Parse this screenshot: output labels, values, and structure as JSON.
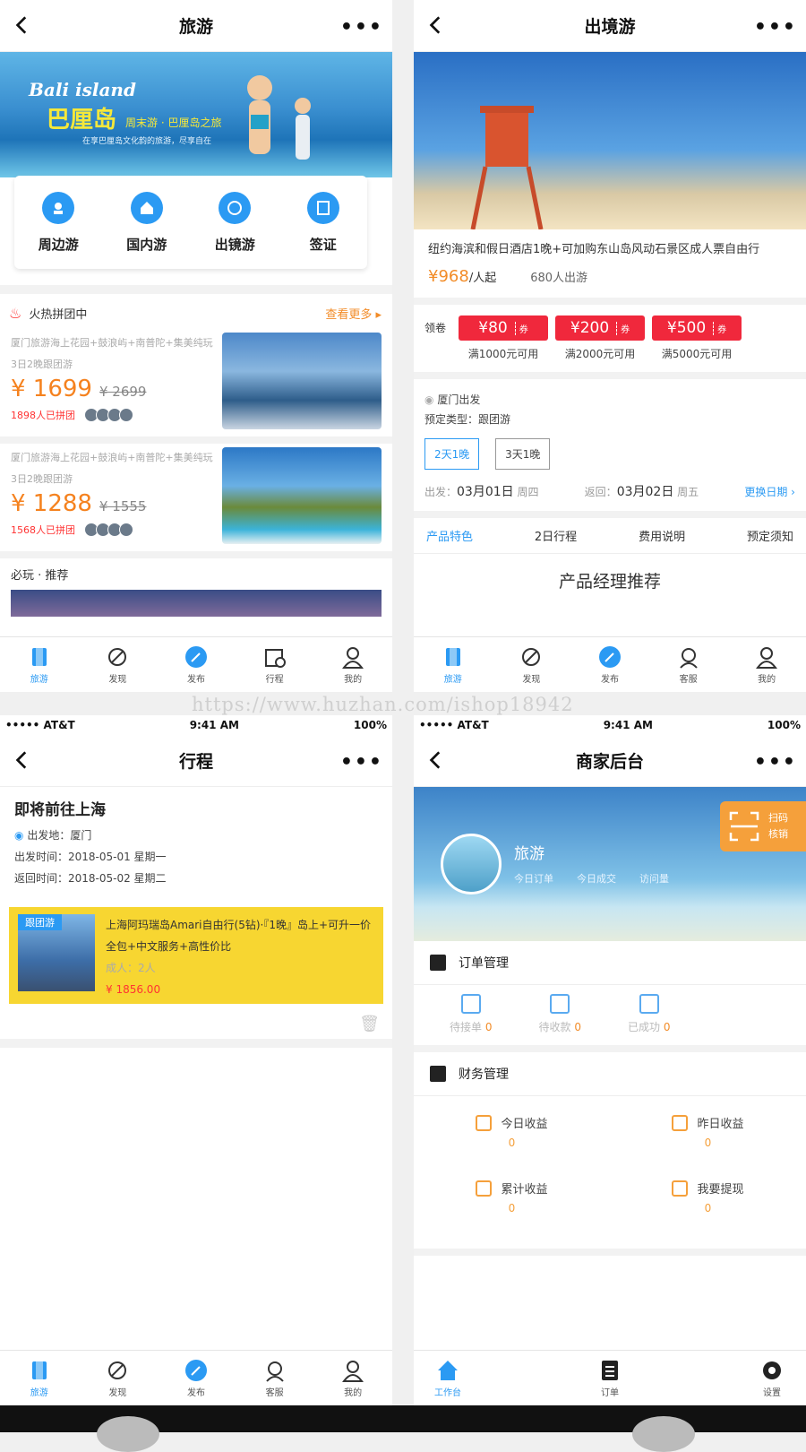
{
  "watermark": "https://www.huzhan.com/ishop18942",
  "tabbar_icons": [
    "tour-icon",
    "discover-icon",
    "publish-icon",
    "itinerary-icon",
    "service-icon",
    "profile-icon"
  ],
  "panel1": {
    "title": "旅游",
    "more": "•••",
    "banner": {
      "brand": "Bali island",
      "brand_cn": "巴厘岛",
      "sub": "周末游 · 巴厘岛之旅",
      "sub2": "在享巴厘岛文化韵的旅游，尽享自在"
    },
    "categories": [
      "周边游",
      "国内游",
      "出镜游",
      "签证"
    ],
    "hot_title": "火热拼团中",
    "see_more": "查看更多",
    "deals": [
      {
        "title": "厦门旅游海上花园+鼓浪屿+南普陀+集美纯玩3日2晚跟团游",
        "price": "¥ 1699",
        "old": "¥ 2699",
        "count": "1898人已拼团"
      },
      {
        "title": "厦门旅游海上花园+鼓浪屿+南普陀+集美纯玩3日2晚跟团游",
        "price": "¥ 1288",
        "old": "¥ 1555",
        "count": "1568人已拼团"
      }
    ],
    "recommend": "必玩 · 推荐",
    "tabs": [
      "旅游",
      "发现",
      "发布",
      "行程",
      "我的"
    ]
  },
  "panel2": {
    "title": "出境游",
    "more": "•••",
    "product": "纽约海滨和假日酒店1晚+可加购东山岛风动石景区成人票自由行",
    "price": "¥968",
    "price_unit": "/人起",
    "sold": "680人出游",
    "coupon_label": "领卷",
    "coupons": [
      {
        "amount": "¥80",
        "tag": "券",
        "cond": "满1000元可用"
      },
      {
        "amount": "¥200",
        "tag": "券",
        "cond": "满2000元可用"
      },
      {
        "amount": "¥500",
        "tag": "券",
        "cond": "满5000元可用"
      }
    ],
    "depart_city": "厦门出发",
    "booking_type": "预定类型：跟团游",
    "durations": [
      "2天1晚",
      "3天1晚"
    ],
    "depart_label": "出发：",
    "depart_date": "03月01日",
    "depart_week": "周四",
    "return_label": "返回：",
    "return_date": "03月02日",
    "return_week": "周五",
    "change_date": "更换日期",
    "detail_tabs": [
      "产品特色",
      "2日行程",
      "费用说明",
      "预定须知"
    ],
    "manager_title": "产品经理推荐",
    "tabs": [
      "旅游",
      "发现",
      "发布",
      "客服",
      "我的"
    ]
  },
  "panel3": {
    "status": {
      "carrier": "••••• AT&T",
      "time": "9:41 AM",
      "battery": "100%"
    },
    "title": "行程",
    "more": "•••",
    "heading": "即将前往上海",
    "from": "出发地：厦门",
    "depart_time": "出发时间：2018-05-01 星期一",
    "return_time": "返回时间：2018-05-02 星期二",
    "card": {
      "tag": "跟团游",
      "title": "上海阿玛瑞岛Amari自由行(5钻)·『1晚』岛上+可升一价全包+中文服务+高性价比",
      "people": "成人：2人",
      "price": "¥ 1856.00"
    },
    "tabs": [
      "旅游",
      "发现",
      "发布",
      "客服",
      "我的"
    ]
  },
  "panel4": {
    "status": {
      "carrier": "••••• AT&T",
      "time": "9:41 AM",
      "battery": "100%"
    },
    "title": "商家后台",
    "more": "•••",
    "shop_name": "旅游",
    "shop_stats": [
      "今日订单",
      "今日成交",
      "访问量"
    ],
    "scan": [
      "扫码",
      "核销"
    ],
    "order_mgmt": "订单管理",
    "orders": [
      {
        "label": "待接单",
        "count": "0"
      },
      {
        "label": "待收款",
        "count": "0"
      },
      {
        "label": "已成功",
        "count": "0"
      }
    ],
    "finance_mgmt": "财务管理",
    "finance": [
      {
        "label": "今日收益",
        "value": "0"
      },
      {
        "label": "昨日收益",
        "value": "0"
      },
      {
        "label": "累计收益",
        "value": "0"
      },
      {
        "label": "我要提现",
        "value": "0"
      }
    ],
    "tabs": [
      "工作台",
      "订单",
      "设置"
    ]
  }
}
